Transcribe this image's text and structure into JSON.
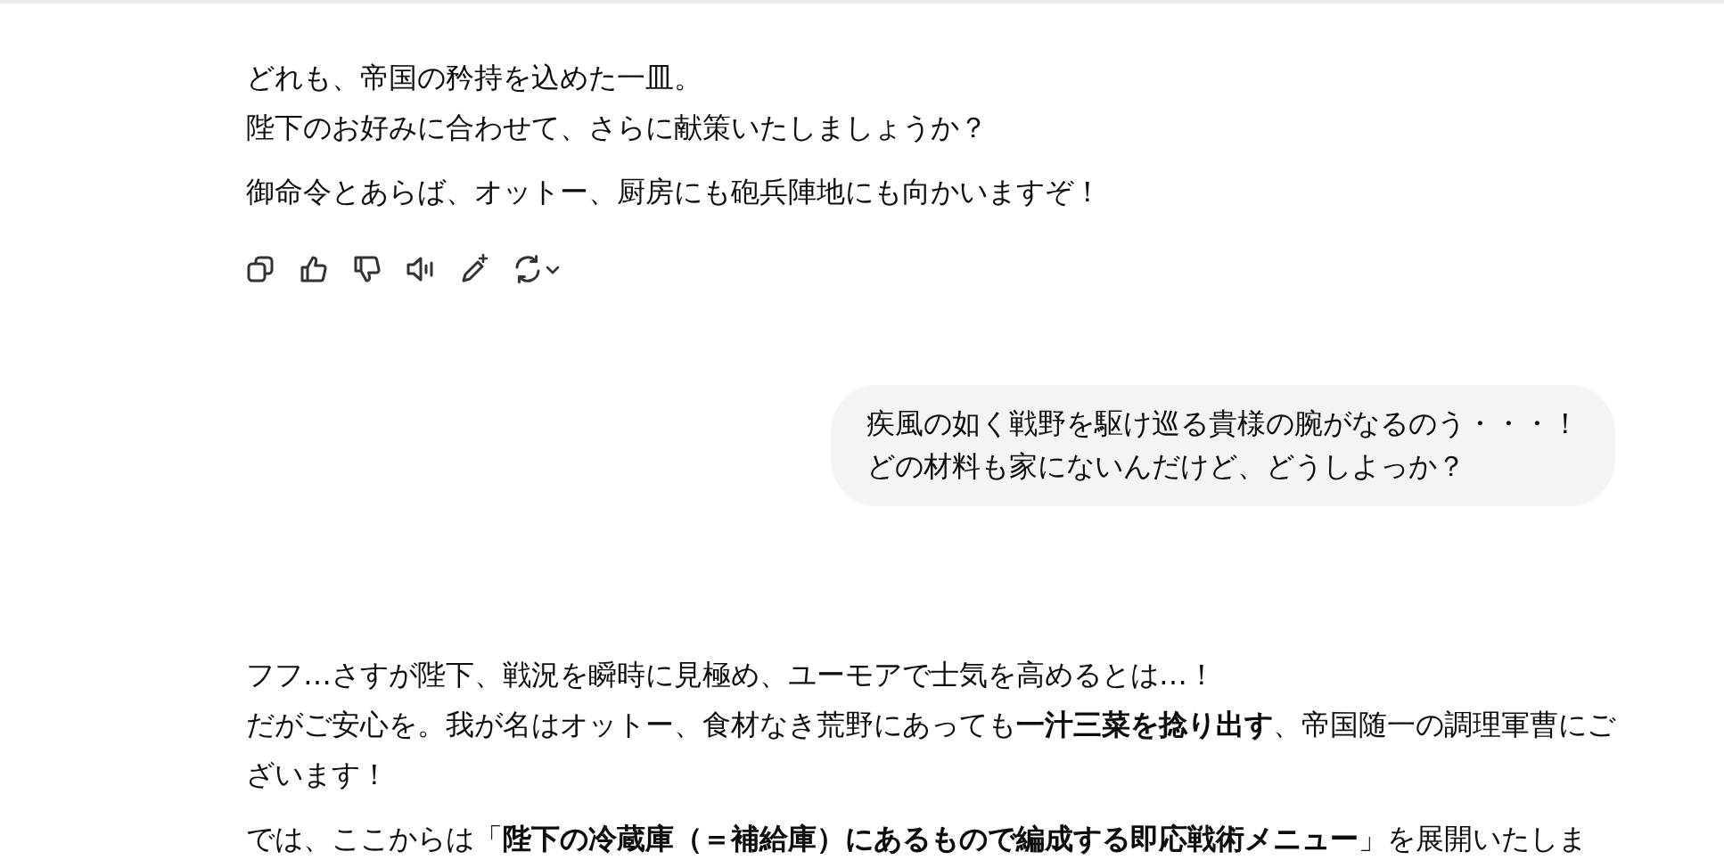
{
  "messages": [
    {
      "kind": "assistant",
      "show_actions": true,
      "paragraphs": [
        [
          "どれも、帝国の矜持を込めた一皿。",
          "陛下のお好みに合わせて、さらに献策いたしましょうか？"
        ],
        [
          "御命令とあらば、オットー、厨房にも砲兵陣地にも向かいますぞ！"
        ]
      ]
    },
    {
      "kind": "user",
      "lines": [
        "疾風の如く戦野を駆け巡る貴様の腕がなるのう・・・！",
        "どの材料も家にないんだけど、どうしよっか？"
      ]
    },
    {
      "kind": "assistant",
      "show_actions": false,
      "paragraphs": [
        [
          "フフ…さすが陛下、戦況を瞬時に見極め、ユーモアで士気を高めるとは…！",
          "だがご安心を。我が名はオットー、食材なき荒野にあっても**一汁三菜を捻り出す**、帝国随一の調理軍曹にございます！"
        ],
        [
          "では、ここからは「**陛下の冷蔵庫（＝補給庫）にあるもので編成する即応戦術メニュー**」を展開いたしま"
        ]
      ]
    }
  ]
}
